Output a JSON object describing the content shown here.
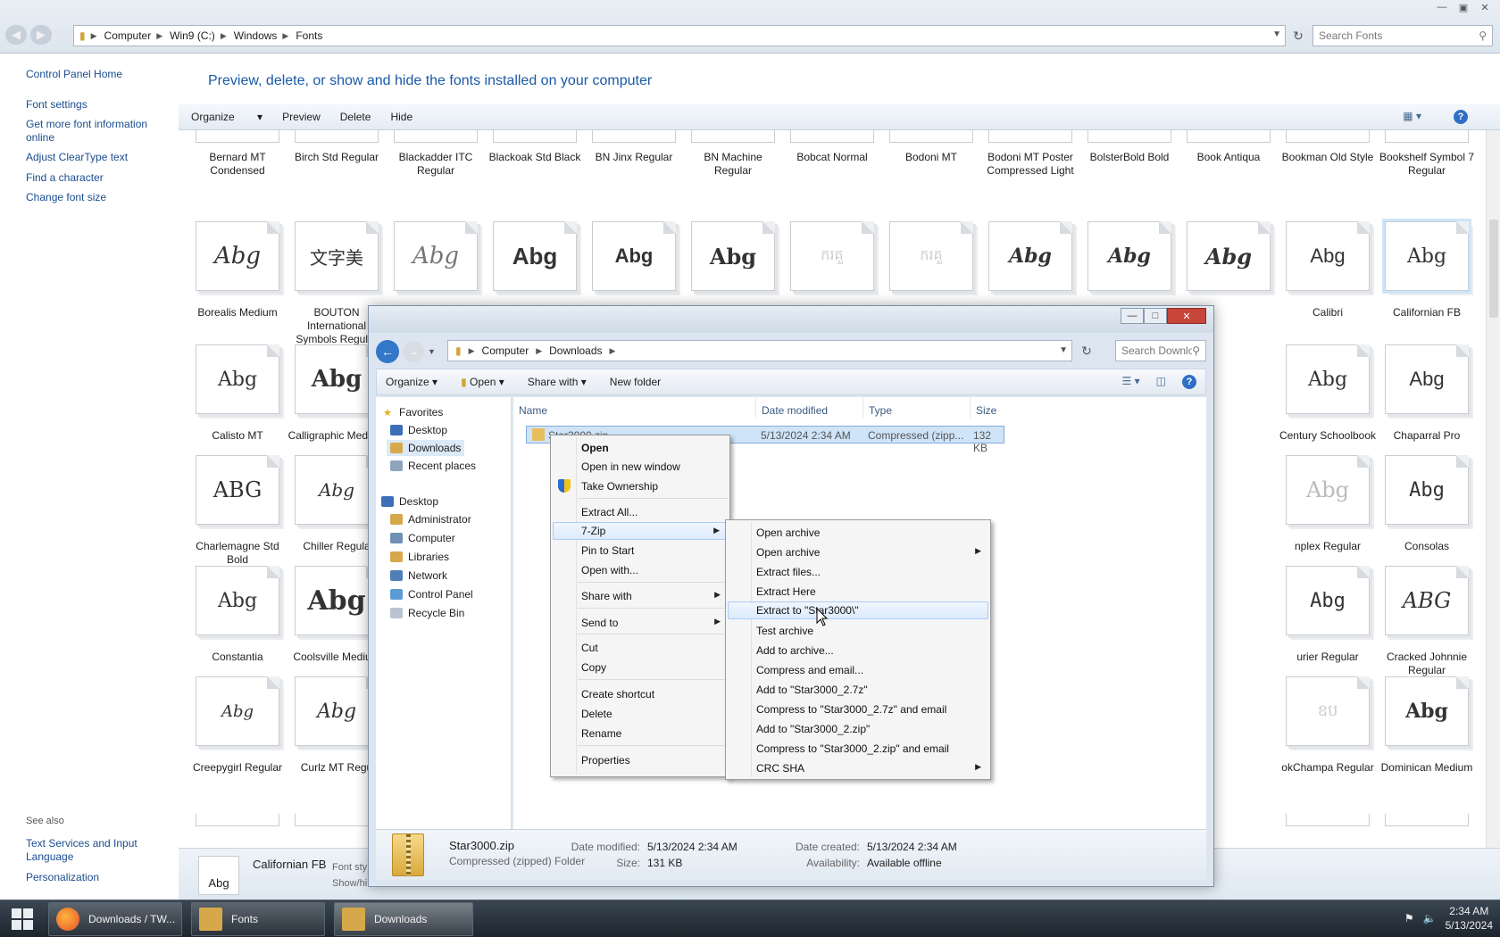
{
  "fonts_window": {
    "address": [
      "Computer",
      "Win9 (C:)",
      "Windows",
      "Fonts"
    ],
    "search_placeholder": "Search Fonts",
    "side_links": [
      "Control Panel Home",
      "Font settings",
      "Get more font information online",
      "Adjust ClearType text",
      "Find a character",
      "Change font size"
    ],
    "see_also": "See also",
    "see_also_links": [
      "Text Services and Input Language",
      "Personalization"
    ],
    "headline": "Preview, delete, or show and hide the fonts installed on your computer",
    "toolbar": [
      "Organize",
      "Preview",
      "Delete",
      "Hide"
    ],
    "row0": [
      "Bernard MT Condensed",
      "Birch Std Regular",
      "Blackadder ITC Regular",
      "Blackoak Std Black",
      "BN Jinx Regular",
      "BN Machine Regular",
      "Bobcat Normal",
      "Bodoni MT",
      "Bodoni MT Poster Compressed Light",
      "BolsterBold Bold",
      "Book Antiqua",
      "Bookman Old Style",
      "Bookshelf Symbol 7 Regular"
    ],
    "row1": [
      {
        "label": "Borealis Medium",
        "sample": "Abg"
      },
      {
        "label": "BOUTON International Symbols Regular",
        "sample": "文字美"
      },
      {
        "label": "",
        "sample": "Abg"
      },
      {
        "label": "",
        "sample": "Abg"
      },
      {
        "label": "",
        "sample": "Abg"
      },
      {
        "label": "",
        "sample": "Abg"
      },
      {
        "label": "",
        "sample": "ករគួ"
      },
      {
        "label": "",
        "sample": "ករគួ"
      },
      {
        "label": "",
        "sample": "Abg"
      },
      {
        "label": "",
        "sample": "Abg"
      },
      {
        "label": "",
        "sample": "Abg"
      },
      {
        "label": "Calibri",
        "sample": "Abg"
      },
      {
        "label": "Californian FB",
        "sample": "Abg"
      }
    ],
    "left_col": [
      {
        "label": "Calisto MT",
        "sample": "Abg"
      },
      {
        "label": "Charlemagne Std Bold",
        "sample": "ABG"
      },
      {
        "label": "Constantia",
        "sample": "Abg"
      },
      {
        "label": "Creepygirl Regular",
        "sample": "Abg"
      }
    ],
    "second_col": [
      {
        "label": "Calligraphic Medium",
        "sample": "Abg"
      },
      {
        "label": "Chiller Regula",
        "sample": "Abg"
      },
      {
        "label": "Coolsville Medium",
        "sample": "Abg"
      },
      {
        "label": "Curlz MT Regu",
        "sample": "Abg"
      }
    ],
    "right_col_a": [
      {
        "label": "Century Schoolbook",
        "sample": "Abg"
      },
      {
        "label": "nplex Regular",
        "sample": "Abg"
      },
      {
        "label": "urier Regular",
        "sample": "Abg"
      },
      {
        "label": "okChampa Regular",
        "sample": "ឧប"
      }
    ],
    "right_col_b": [
      {
        "label": "Chaparral Pro",
        "sample": "Abg"
      },
      {
        "label": "Consolas",
        "sample": "Abg"
      },
      {
        "label": "Cracked Johnnie Regular",
        "sample": "ABG"
      },
      {
        "label": "Dominican Medium",
        "sample": "Abg"
      }
    ],
    "details": {
      "thumb": "Abg",
      "name": "Californian FB",
      "meta1": "Font sty",
      "meta2": "Show/hi"
    }
  },
  "downloads_window": {
    "address": [
      "Computer",
      "Downloads"
    ],
    "search_placeholder": "Search Downloads",
    "toolbar": {
      "organize": "Organize",
      "open": "Open",
      "share": "Share with",
      "new_folder": "New folder"
    },
    "nav": {
      "favorites": "Favorites",
      "fav_items": [
        "Desktop",
        "Downloads",
        "Recent places"
      ],
      "desktop": "Desktop",
      "desktop_items": [
        "Administrator",
        "Computer",
        "Libraries",
        "Network",
        "Control Panel",
        "Recycle Bin"
      ]
    },
    "columns": [
      "Name",
      "Date modified",
      "Type",
      "Size"
    ],
    "file": {
      "name": "Star3000.zip",
      "date": "5/13/2024 2:34 AM",
      "type": "Compressed (zipp...",
      "size": "132 KB"
    },
    "details": {
      "name": "Star3000.zip",
      "type": "Compressed (zipped) Folder",
      "k_modified": "Date modified:",
      "modified": "5/13/2024 2:34 AM",
      "k_size": "Size:",
      "size": "131 KB",
      "k_created": "Date created:",
      "created": "5/13/2024 2:34 AM",
      "k_avail": "Availability:",
      "avail": "Available offline"
    }
  },
  "context_menu": {
    "items": [
      "Open",
      "Open in new window",
      "Take Ownership",
      "Extract All...",
      "7-Zip",
      "Pin to Start",
      "Open with...",
      "Share with",
      "Send to",
      "Cut",
      "Copy",
      "Create shortcut",
      "Delete",
      "Rename",
      "Properties"
    ]
  },
  "submenu": {
    "items": [
      "Open archive",
      "Open archive",
      "Extract files...",
      "Extract Here",
      "Extract to \"Star3000\\\"",
      "Test archive",
      "Add to archive...",
      "Compress and email...",
      "Add to \"Star3000_2.7z\"",
      "Compress to \"Star3000_2.7z\" and email",
      "Add to \"Star3000_2.zip\"",
      "Compress to \"Star3000_2.zip\" and email",
      "CRC SHA"
    ]
  },
  "taskbar": {
    "buttons": [
      "Downloads / TW...",
      "Fonts",
      "Downloads"
    ],
    "time": "2:34 AM",
    "date": "5/13/2024"
  }
}
